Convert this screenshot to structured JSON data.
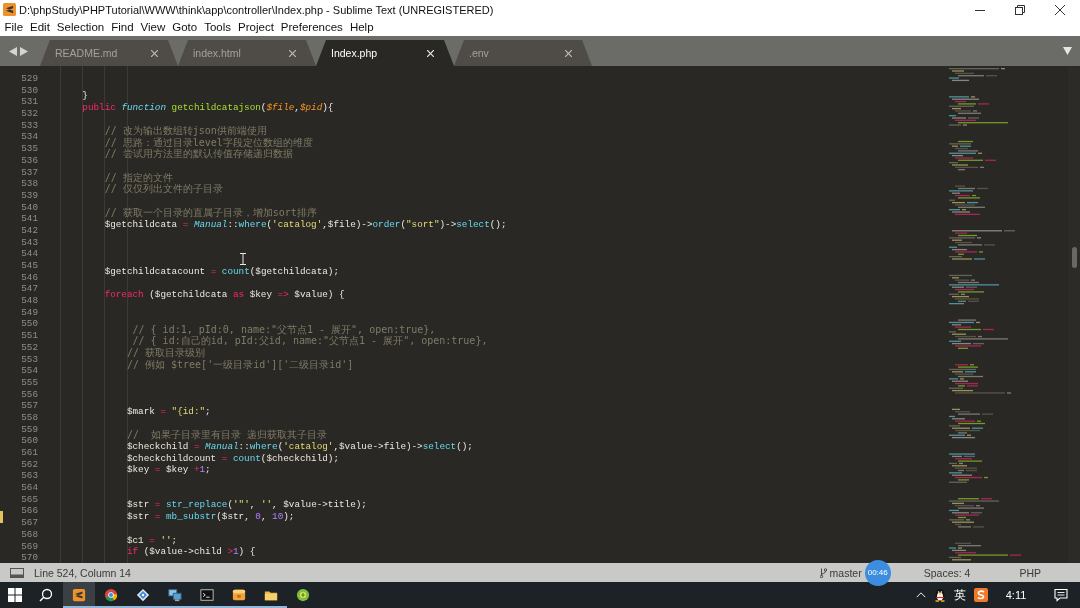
{
  "window": {
    "title": "D:\\phpStudy\\PHPTutorial\\WWW\\think\\app\\controller\\Index.php - Sublime Text (UNREGISTERED)"
  },
  "menu": [
    "File",
    "Edit",
    "Selection",
    "Find",
    "View",
    "Goto",
    "Tools",
    "Project",
    "Preferences",
    "Help"
  ],
  "tabs": [
    {
      "label": "README.md",
      "selected": false
    },
    {
      "label": "index.html",
      "selected": false
    },
    {
      "label": "Index.php",
      "selected": true
    },
    {
      "label": ".env",
      "selected": false
    }
  ],
  "editor": {
    "lines": [
      {
        "number": "529",
        "modified": false
      },
      {
        "number": "530",
        "modified": false
      },
      {
        "number": "531",
        "modified": false,
        "tokens": [
          {
            "text": "    }",
            "kind": "plain"
          }
        ]
      },
      {
        "number": "532",
        "modified": false,
        "tokens": [
          {
            "text": "    public",
            "kind": "keyword"
          },
          {
            "text": " function",
            "kind": "storage"
          },
          {
            "text": " getchildcatajson",
            "kind": "entity"
          },
          {
            "text": "(",
            "kind": "plain"
          },
          {
            "text": "$file",
            "kind": "param"
          },
          {
            "text": ",",
            "kind": "plain"
          },
          {
            "text": "$pid",
            "kind": "param"
          },
          {
            "text": "){",
            "kind": "plain"
          }
        ]
      },
      {
        "number": "533",
        "modified": false
      },
      {
        "number": "534",
        "modified": false,
        "tokens": [
          {
            "text": "        // 改为输出数组转json供前端使用",
            "kind": "comment"
          }
        ]
      },
      {
        "number": "535",
        "modified": false,
        "tokens": [
          {
            "text": "        // 思路：通过目录level字段定位数组的维度",
            "kind": "comment"
          }
        ]
      },
      {
        "number": "536",
        "modified": false,
        "tokens": [
          {
            "text": "        // 尝试用方法里的默认传值存储递归数据",
            "kind": "comment"
          }
        ]
      },
      {
        "number": "537",
        "modified": false
      },
      {
        "number": "538",
        "modified": false,
        "tokens": [
          {
            "text": "        // 指定的文件",
            "kind": "comment"
          }
        ]
      },
      {
        "number": "539",
        "modified": false,
        "tokens": [
          {
            "text": "        // 仅仅列出文件的子目录",
            "kind": "comment"
          }
        ]
      },
      {
        "number": "540",
        "modified": false
      },
      {
        "number": "541",
        "modified": false,
        "tokens": [
          {
            "text": "        // 获取一个目录的直属子目录，增加sort排序",
            "kind": "comment"
          }
        ]
      },
      {
        "number": "542",
        "modified": false,
        "tokens": [
          {
            "text": "        $getchildcata ",
            "kind": "plain"
          },
          {
            "text": "=",
            "kind": "operator"
          },
          {
            "text": " Manual",
            "kind": "class"
          },
          {
            "text": "::",
            "kind": "plain"
          },
          {
            "text": "where",
            "kind": "support"
          },
          {
            "text": "(",
            "kind": "plain"
          },
          {
            "text": "'catalog'",
            "kind": "string"
          },
          {
            "text": ",$file)->",
            "kind": "plain"
          },
          {
            "text": "order",
            "kind": "support"
          },
          {
            "text": "(",
            "kind": "plain"
          },
          {
            "text": "\"sort\"",
            "kind": "string"
          },
          {
            "text": ")->",
            "kind": "plain"
          },
          {
            "text": "select",
            "kind": "support"
          },
          {
            "text": "();",
            "kind": "plain"
          }
        ]
      },
      {
        "number": "543",
        "modified": false
      },
      {
        "number": "544",
        "modified": false
      },
      {
        "number": "545",
        "modified": false
      },
      {
        "number": "546",
        "modified": false,
        "tokens": [
          {
            "text": "        $getchildcatacount ",
            "kind": "plain"
          },
          {
            "text": "=",
            "kind": "operator"
          },
          {
            "text": " count",
            "kind": "support"
          },
          {
            "text": "($getchildcata);",
            "kind": "plain"
          }
        ]
      },
      {
        "number": "547",
        "modified": false
      },
      {
        "number": "548",
        "modified": false,
        "tokens": [
          {
            "text": "        foreach",
            "kind": "keyword"
          },
          {
            "text": " ($getchildcata ",
            "kind": "plain"
          },
          {
            "text": "as",
            "kind": "keyword"
          },
          {
            "text": " $key ",
            "kind": "plain"
          },
          {
            "text": "=>",
            "kind": "operator"
          },
          {
            "text": " $value) {",
            "kind": "plain"
          }
        ]
      },
      {
        "number": "549",
        "modified": false
      },
      {
        "number": "550",
        "modified": false
      },
      {
        "number": "551",
        "modified": false,
        "tokens": [
          {
            "text": "             // { id:1, pId:0, name:\"父节点1 - 展开\", open:true},",
            "kind": "comment"
          }
        ]
      },
      {
        "number": "552",
        "modified": false,
        "tokens": [
          {
            "text": "             // { id:自己的id, pId:父id, name:\"父节点1 - 展开\", open:true},",
            "kind": "comment"
          }
        ]
      },
      {
        "number": "553",
        "modified": false,
        "tokens": [
          {
            "text": "            // 获取目录级别",
            "kind": "comment"
          }
        ]
      },
      {
        "number": "554",
        "modified": false,
        "tokens": [
          {
            "text": "            // 例如 $tree['一级目录id']['二级目录id']",
            "kind": "comment"
          }
        ]
      },
      {
        "number": "555",
        "modified": false
      },
      {
        "number": "556",
        "modified": false
      },
      {
        "number": "557",
        "modified": false
      },
      {
        "number": "558",
        "modified": false,
        "tokens": [
          {
            "text": "            $mark ",
            "kind": "plain"
          },
          {
            "text": "=",
            "kind": "operator"
          },
          {
            "text": " \"{id:\"",
            "kind": "string"
          },
          {
            "text": ";",
            "kind": "plain"
          }
        ]
      },
      {
        "number": "559",
        "modified": false
      },
      {
        "number": "560",
        "modified": false,
        "tokens": [
          {
            "text": "            //  如果子目录里有目录 递归获取其子目录",
            "kind": "comment"
          }
        ]
      },
      {
        "number": "561",
        "modified": false,
        "tokens": [
          {
            "text": "            $checkchild ",
            "kind": "plain"
          },
          {
            "text": "=",
            "kind": "operator"
          },
          {
            "text": " Manual",
            "kind": "class"
          },
          {
            "text": "::",
            "kind": "plain"
          },
          {
            "text": "where",
            "kind": "support"
          },
          {
            "text": "(",
            "kind": "plain"
          },
          {
            "text": "'catalog'",
            "kind": "string"
          },
          {
            "text": ",$value->file)->",
            "kind": "plain"
          },
          {
            "text": "select",
            "kind": "support"
          },
          {
            "text": "();",
            "kind": "plain"
          }
        ]
      },
      {
        "number": "562",
        "modified": false,
        "tokens": [
          {
            "text": "            $checkchildcount ",
            "kind": "plain"
          },
          {
            "text": "=",
            "kind": "operator"
          },
          {
            "text": " count",
            "kind": "support"
          },
          {
            "text": "($checkchild);",
            "kind": "plain"
          }
        ]
      },
      {
        "number": "563",
        "modified": false,
        "tokens": [
          {
            "text": "            $key ",
            "kind": "plain"
          },
          {
            "text": "=",
            "kind": "operator"
          },
          {
            "text": " $key ",
            "kind": "plain"
          },
          {
            "text": "+",
            "kind": "operator"
          },
          {
            "text": "1",
            "kind": "number"
          },
          {
            "text": ";",
            "kind": "plain"
          }
        ]
      },
      {
        "number": "564",
        "modified": false
      },
      {
        "number": "565",
        "modified": false
      },
      {
        "number": "566",
        "modified": false,
        "tokens": [
          {
            "text": "            $str ",
            "kind": "plain"
          },
          {
            "text": "=",
            "kind": "operator"
          },
          {
            "text": " str_replace",
            "kind": "support"
          },
          {
            "text": "(",
            "kind": "plain"
          },
          {
            "text": "'\"'",
            "kind": "string"
          },
          {
            "text": ", ",
            "kind": "plain"
          },
          {
            "text": "''",
            "kind": "string"
          },
          {
            "text": ", $value->title);",
            "kind": "plain"
          }
        ]
      },
      {
        "number": "567",
        "modified": true,
        "tokens": [
          {
            "text": "            $str ",
            "kind": "plain"
          },
          {
            "text": "=",
            "kind": "operator"
          },
          {
            "text": " mb_substr",
            "kind": "support"
          },
          {
            "text": "($str, ",
            "kind": "plain"
          },
          {
            "text": "0",
            "kind": "number"
          },
          {
            "text": ", ",
            "kind": "plain"
          },
          {
            "text": "10",
            "kind": "number"
          },
          {
            "text": ");",
            "kind": "plain"
          }
        ]
      },
      {
        "number": "568",
        "modified": false
      },
      {
        "number": "569",
        "modified": false,
        "tokens": [
          {
            "text": "            $c1 ",
            "kind": "plain"
          },
          {
            "text": "=",
            "kind": "operator"
          },
          {
            "text": " ''",
            "kind": "string"
          },
          {
            "text": ";",
            "kind": "plain"
          }
        ]
      },
      {
        "number": "570",
        "modified": false,
        "tokens": [
          {
            "text": "            if",
            "kind": "keyword"
          },
          {
            "text": " ($value->child ",
            "kind": "plain"
          },
          {
            "text": ">",
            "kind": "operator"
          },
          {
            "text": "1",
            "kind": "number"
          },
          {
            "text": ") {",
            "kind": "plain"
          }
        ]
      }
    ]
  },
  "status_bar": {
    "position": "Line 524, Column 14",
    "branch": "master",
    "indentation": "Spaces: 4",
    "syntax": "PHP"
  },
  "recording_timer": "00:46",
  "taskbar": {
    "apps": [
      {
        "selected": true,
        "running": true
      },
      {
        "selected": false,
        "running": true
      },
      {
        "selected": false,
        "running": true
      },
      {
        "selected": false,
        "running": true
      },
      {
        "selected": false,
        "running": true
      },
      {
        "selected": false,
        "running": true
      },
      {
        "selected": false,
        "running": true
      },
      {
        "selected": false,
        "running": false
      }
    ],
    "input_method": "英",
    "clock": "4:11"
  }
}
